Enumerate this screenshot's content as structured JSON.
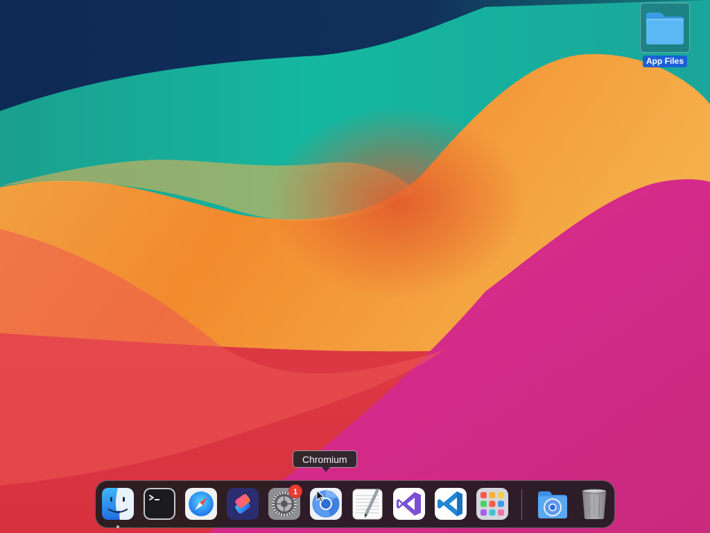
{
  "desktop": {
    "items": [
      {
        "label": "App Files",
        "icon": "folder-icon"
      }
    ]
  },
  "tooltip": {
    "text": "Chromium"
  },
  "dock": {
    "items": [
      {
        "name": "Finder",
        "icon": "finder-icon",
        "running": true
      },
      {
        "name": "Terminal",
        "icon": "terminal-icon"
      },
      {
        "name": "Safari",
        "icon": "safari-icon"
      },
      {
        "name": "Shortcuts",
        "icon": "shortcuts-icon"
      },
      {
        "name": "System Settings",
        "icon": "system-settings-icon",
        "badge": "1"
      },
      {
        "name": "Chromium",
        "icon": "chromium-icon",
        "hovered": true
      },
      {
        "name": "TextEdit",
        "icon": "textedit-icon"
      },
      {
        "name": "Visual Studio",
        "icon": "visual-studio-icon"
      },
      {
        "name": "Visual Studio Code",
        "icon": "vscode-icon"
      },
      {
        "name": "Launchpad",
        "icon": "launchpad-icon"
      },
      {
        "name": "Chromium Folder",
        "icon": "chromium-folder-icon"
      },
      {
        "name": "Trash",
        "icon": "trash-icon"
      }
    ]
  }
}
